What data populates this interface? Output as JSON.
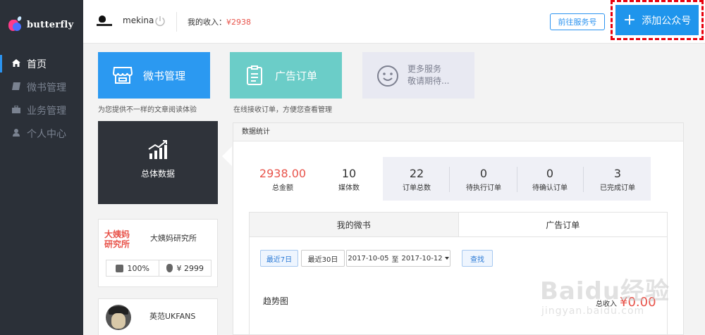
{
  "brand": {
    "name": "butterfly"
  },
  "sidebar": {
    "items": [
      {
        "label": "首页",
        "icon": "home-icon",
        "active": true
      },
      {
        "label": "微书管理",
        "icon": "book-icon",
        "active": false
      },
      {
        "label": "业务管理",
        "icon": "briefcase-icon",
        "active": false
      },
      {
        "label": "个人中心",
        "icon": "user-icon",
        "active": false
      }
    ]
  },
  "topbar": {
    "username": "mekina",
    "income_label": "我的收入：",
    "income_value": "¥2938",
    "service_button": "前往服务号",
    "add_button": "添加公众号"
  },
  "cards": {
    "weishu": {
      "title": "微书管理",
      "caption": "为您提供不一样的文章阅读体验"
    },
    "ad": {
      "title": "广告订单",
      "caption": "在线接收订单，方便您查看管理"
    },
    "more": {
      "line1": "更多服务",
      "line2": "敬请期待..."
    }
  },
  "overall": {
    "label": "总体数据"
  },
  "accounts": [
    {
      "logo_line1": "大姨妈",
      "logo_line2": "研究所",
      "name": "大姨妈研究所",
      "ratio": "100%",
      "earnings": "¥ 2999"
    },
    {
      "name": "英范UKFANS"
    }
  ],
  "stats": {
    "header": "数据统计",
    "total": {
      "value": "2938.00",
      "label": "总金额"
    },
    "media": {
      "value": "10",
      "label": "媒体数"
    },
    "orders": {
      "value": "22",
      "label": "订单总数"
    },
    "pending": {
      "value": "0",
      "label": "待执行订单"
    },
    "to_confirm": {
      "value": "0",
      "label": "待确认订单"
    },
    "completed": {
      "value": "3",
      "label": "已完成订单"
    }
  },
  "tabs": [
    {
      "label": "我的微书",
      "active": false
    },
    {
      "label": "广告订单",
      "active": true
    }
  ],
  "filters": {
    "last7": "最近7日",
    "last30": "最近30日",
    "date_from": "2017-10-05",
    "date_to_sep": "至",
    "date_to": "2017-10-12",
    "search": "查找"
  },
  "trend": {
    "label": "趋势图",
    "total_label": "总收入",
    "total_value": "¥0.00"
  },
  "watermark": {
    "text": "Baidu经验",
    "url": "jingyan.baidu.com"
  },
  "colors": {
    "sidebar": "#2b3038",
    "primary": "#2b99f1",
    "teal": "#6bcdc8",
    "accent_red": "#e8534a",
    "highlight_dash": "#e8000d"
  }
}
